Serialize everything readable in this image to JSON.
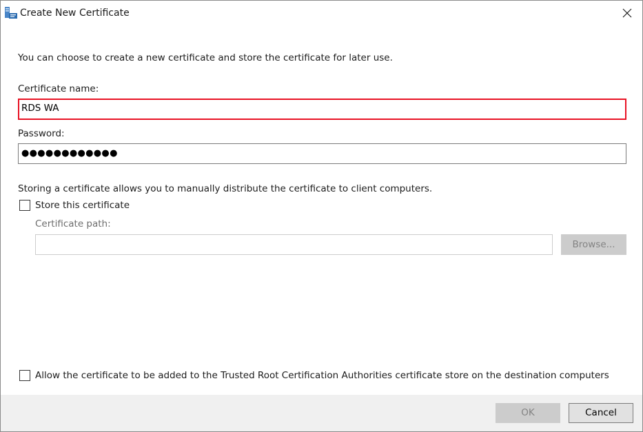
{
  "window": {
    "title": "Create New Certificate",
    "app_icon": "certificate-server-icon",
    "close_icon": "close-icon"
  },
  "intro_text": "You can choose to create a new certificate and store the certificate for later use.",
  "certificate_name": {
    "label": "Certificate name:",
    "value": "RDS WA"
  },
  "password": {
    "label": "Password:",
    "value": "●●●●●●●●●●●●"
  },
  "store": {
    "description": "Storing a certificate allows you to manually distribute the certificate to client computers.",
    "checkbox_label": "Store this certificate",
    "checked": false,
    "path_label": "Certificate path:",
    "path_value": "",
    "browse_label": "Browse..."
  },
  "trusted_root": {
    "checkbox_label": "Allow the certificate to be added to the Trusted Root Certification Authorities certificate store on the destination computers",
    "checked": false
  },
  "footer": {
    "ok_label": "OK",
    "cancel_label": "Cancel"
  },
  "colors": {
    "focus_border": "#e81123",
    "footer_bg": "#f0f0f0",
    "disabled_text": "#838383"
  }
}
